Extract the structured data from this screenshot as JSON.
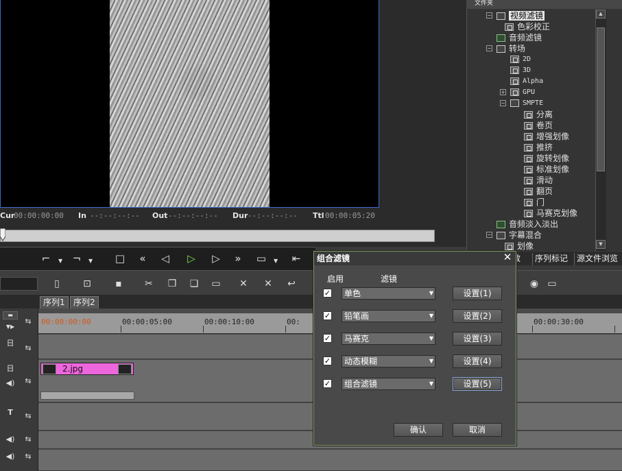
{
  "preview": {
    "timecodes": {
      "cur_label": "Cur",
      "cur_value": "00:00:00:00",
      "in_label": "In",
      "in_value": "--:--:--:--",
      "out_label": "Out",
      "out_value": "--:--:--:--",
      "dur_label": "Dur",
      "dur_value": "--:--:--:--",
      "ttl_label": "Ttl",
      "ttl_value": "00:00:05:20"
    }
  },
  "folder_panel": {
    "header": "文件夹",
    "tree": [
      {
        "label": "视频滤镜",
        "icon": "folder-open-icon",
        "selected": true
      },
      {
        "label": "色彩校正",
        "icon": "filter-icon"
      },
      {
        "label": "音频滤镜",
        "icon": "audio-filter-icon"
      },
      {
        "label": "转场",
        "icon": "folder-open-icon"
      },
      {
        "label": "2D",
        "icon": "transition-icon"
      },
      {
        "label": "3D",
        "icon": "transition-icon"
      },
      {
        "label": "Alpha",
        "icon": "transition-icon"
      },
      {
        "label": "GPU",
        "icon": "transition-icon"
      },
      {
        "label": "SMPTE",
        "icon": "folder-open-icon"
      },
      {
        "label": "分离",
        "icon": "transition-icon"
      },
      {
        "label": "卷页",
        "icon": "transition-icon"
      },
      {
        "label": "增强划像",
        "icon": "transition-icon"
      },
      {
        "label": "推挤",
        "icon": "transition-icon"
      },
      {
        "label": "旋转划像",
        "icon": "transition-icon"
      },
      {
        "label": "标准划像",
        "icon": "transition-icon"
      },
      {
        "label": "滑动",
        "icon": "transition-icon"
      },
      {
        "label": "翻页",
        "icon": "transition-icon"
      },
      {
        "label": "门",
        "icon": "transition-icon"
      },
      {
        "label": "马赛克划像",
        "icon": "transition-icon"
      },
      {
        "label": "音频淡入淡出",
        "icon": "audio-filter-icon"
      },
      {
        "label": "字幕混合",
        "icon": "folder-open-icon"
      },
      {
        "label": "划像",
        "icon": "title-icon"
      }
    ],
    "tabs": [
      "效",
      "序列标记",
      "源文件浏览"
    ]
  },
  "sequence_tabs": [
    "序列1",
    "序列2"
  ],
  "timeline": {
    "ruler_labels": [
      "00:00:00:00",
      "00:00:05:00",
      "00:00:10:00",
      "00:",
      "00:00:30:00"
    ],
    "clip_label": "2.jpg"
  },
  "dialog": {
    "title": "组合滤镜",
    "close_glyph": "✕",
    "col_enable": "启用",
    "col_filter": "滤镜",
    "rows": [
      {
        "checked": true,
        "filter": "单色",
        "button": "设置(1)"
      },
      {
        "checked": true,
        "filter": "铅笔画",
        "button": "设置(2)"
      },
      {
        "checked": true,
        "filter": "马赛克",
        "button": "设置(3)"
      },
      {
        "checked": true,
        "filter": "动态模糊",
        "button": "设置(4)"
      },
      {
        "checked": true,
        "filter": "组合滤镜",
        "button": "设置(5)"
      }
    ],
    "ok_label": "确认",
    "cancel_label": "取消"
  },
  "colors": {
    "play_green": "#7ee04e",
    "clip_pink": "#ee66dd",
    "ruler_start_orange": "#d05a1a",
    "dialog_border": "#7d9b5c",
    "selection_blue": "#3a6bd0"
  }
}
